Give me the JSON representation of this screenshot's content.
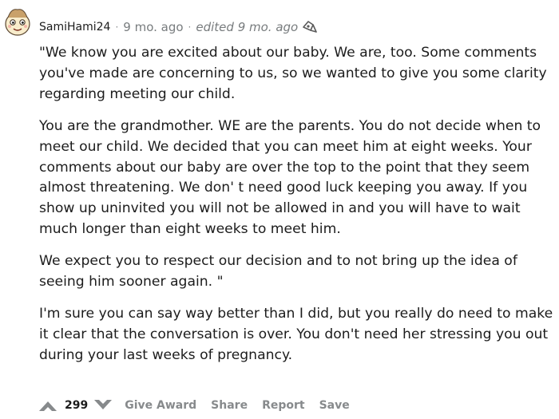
{
  "comment": {
    "username": "SamiHami24",
    "age": "9 mo. ago",
    "edited": "edited 9 mo. ago",
    "paragraphs": [
      "\"We know you are excited about our baby. We are, too. Some comments you've made are concerning to us, so we wanted to give you some clarity regarding meeting our child.",
      "You are the grandmother. WE are the parents. You do not decide when to meet our child. We decided that you can meet him at eight weeks. Your comments about our baby are over the top to the point that they seem almost threatening. We don' t need good luck keeping you away. If you show up uninvited you will not be allowed in and you will have to wait much longer than eight weeks to meet him.",
      "We expect you to respect our decision and to not bring up the idea of seeing him sooner again. \"",
      "I'm sure you can say way better than I did, but you really do need to make it clear that the conversation is over. You don't need her stressing you out during your last weeks of pregnancy."
    ],
    "score": "299"
  },
  "actions": {
    "give_award": "Give Award",
    "share": "Share",
    "report": "Report",
    "save": "Save"
  },
  "icons": {
    "avatar": "snoo-avatar-icon",
    "edit": "award-mini-icon",
    "upvote": "upvote-arrow-icon",
    "downvote": "downvote-arrow-icon"
  },
  "colors": {
    "text": "#1c1c1c",
    "meta": "#787c7e",
    "action": "#878a8c",
    "avatar_face": "#fbeec0"
  }
}
